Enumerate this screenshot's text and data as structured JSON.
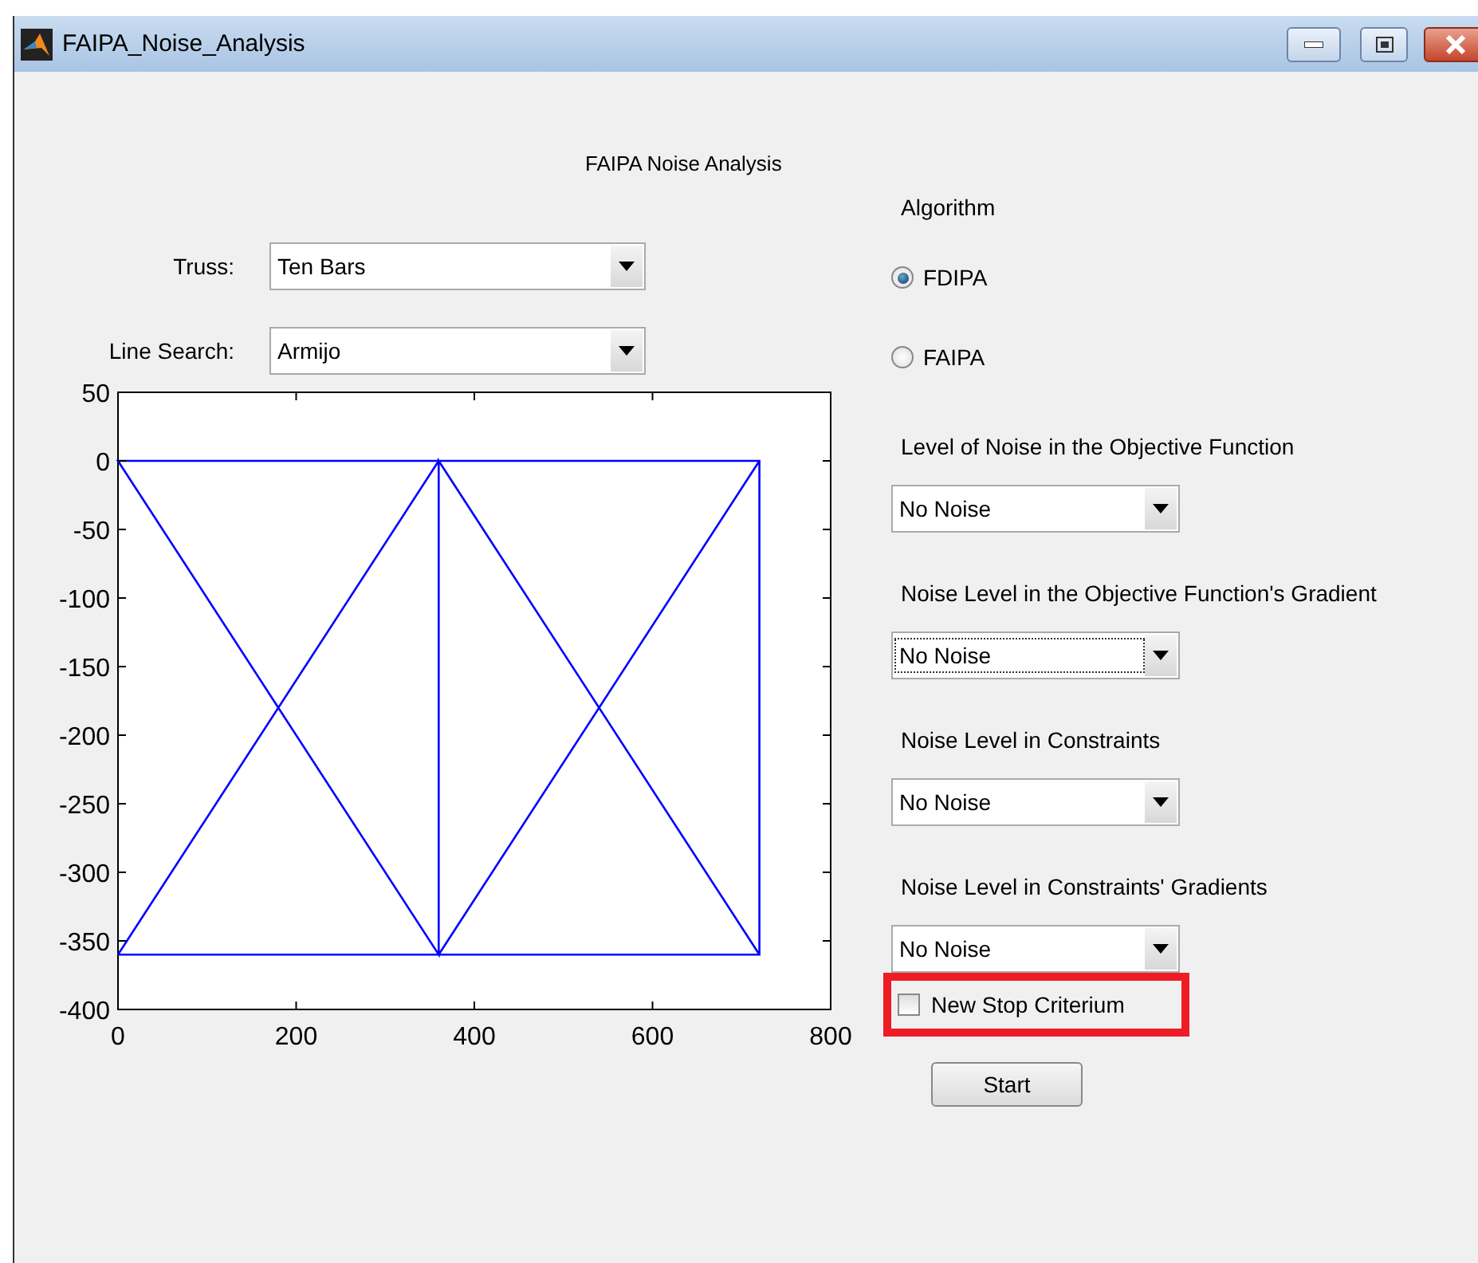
{
  "window": {
    "title": "FAIPA_Noise_Analysis"
  },
  "heading": "FAIPA Noise Analysis",
  "left_fields": [
    {
      "label": "Truss:",
      "value": "Ten Bars"
    },
    {
      "label": "Line Search:",
      "value": "Armijo"
    }
  ],
  "plot": {
    "chart_data": {
      "type": "line",
      "xlim": [
        0,
        800
      ],
      "ylim": [
        -400,
        50
      ],
      "xticks": [
        0,
        200,
        400,
        600,
        800
      ],
      "yticks": [
        50,
        0,
        -50,
        -100,
        -150,
        -200,
        -250,
        -300,
        -350,
        -400
      ],
      "series": [
        {
          "color": "#0000ff",
          "x": [
            0,
            360,
            720,
            720,
            360,
            0,
            360,
            360,
            720,
            null,
            0,
            360,
            null,
            360,
            720
          ],
          "values": [
            -360,
            -360,
            -360,
            0,
            0,
            0,
            -360,
            0,
            -360,
            null,
            -360,
            0,
            null,
            -360,
            0
          ]
        }
      ]
    }
  },
  "algorithm": {
    "label": "Algorithm",
    "options": [
      {
        "label": "FDIPA",
        "selected": true
      },
      {
        "label": "FAIPA",
        "selected": false
      }
    ]
  },
  "noise_settings": [
    {
      "label": "Level of Noise in the Objective Function",
      "value": "No Noise",
      "focused": false
    },
    {
      "label": "Noise Level in the Objective Function's Gradient",
      "value": "No Noise",
      "focused": true
    },
    {
      "label": "Noise Level in Constraints",
      "value": "No Noise",
      "focused": false
    },
    {
      "label": "Noise Level in Constraints' Gradients",
      "value": "No Noise",
      "focused": false
    }
  ],
  "stop_criterion": {
    "label": "New Stop Criterium",
    "checked": false,
    "highlighted": true
  },
  "start_button": "Start"
}
